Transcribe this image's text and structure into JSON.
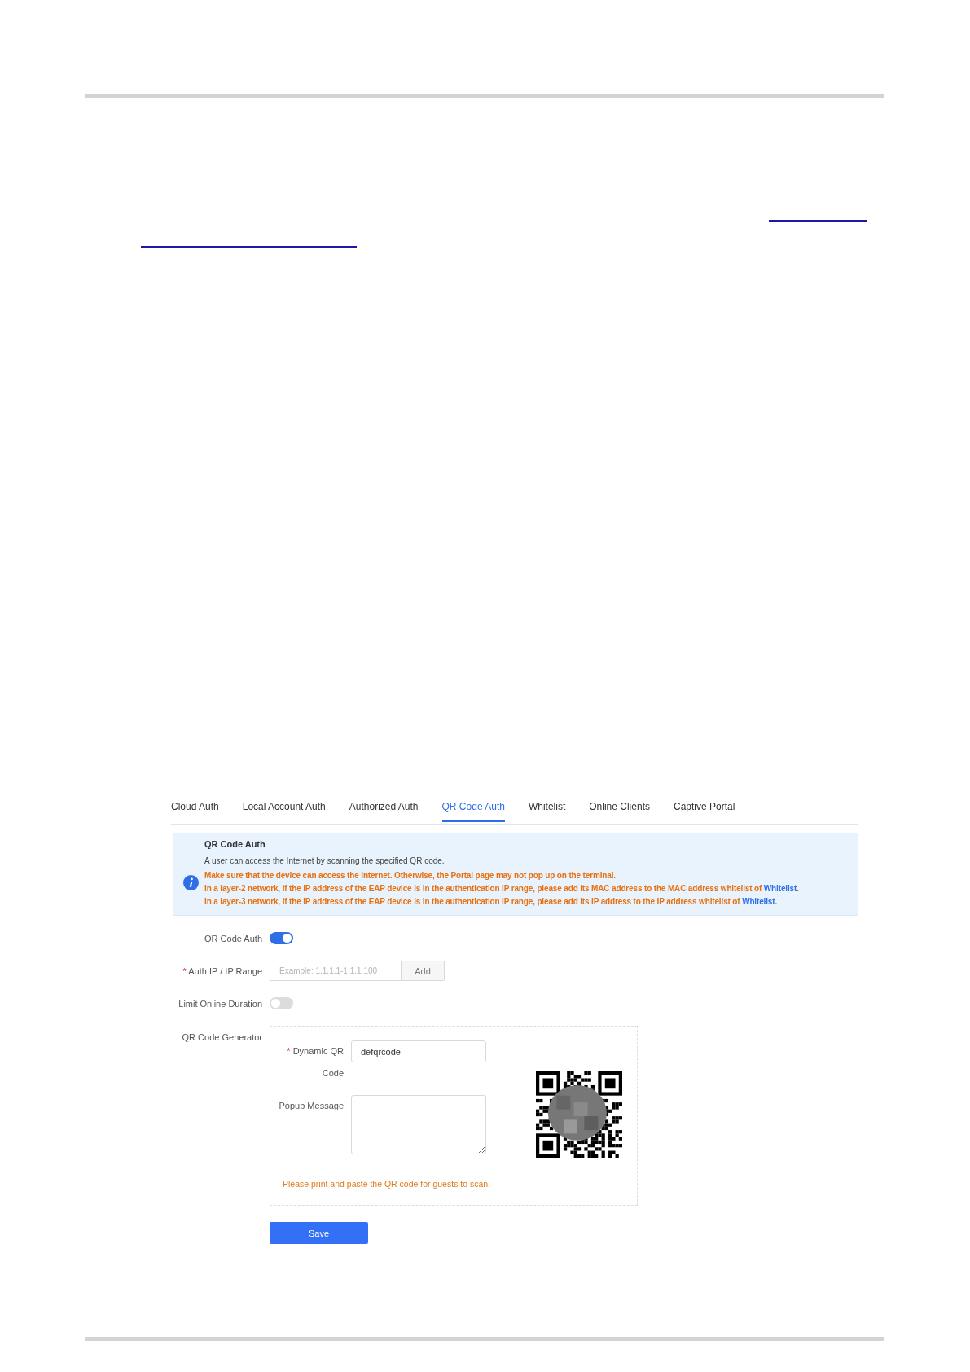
{
  "tabs": [
    {
      "label": "Cloud Auth",
      "selected": false
    },
    {
      "label": "Local Account Auth",
      "selected": false
    },
    {
      "label": "Authorized Auth",
      "selected": false
    },
    {
      "label": "QR Code Auth",
      "selected": true
    },
    {
      "label": "Whitelist",
      "selected": false
    },
    {
      "label": "Online Clients",
      "selected": false
    },
    {
      "label": "Captive Portal",
      "selected": false
    }
  ],
  "notice": {
    "title": "QR Code Auth",
    "description": "A user can access the Internet by scanning the specified QR code.",
    "warnings": [
      {
        "text": "Make sure that the device can access the Internet. Otherwise, the Portal page may not pop up on the terminal."
      },
      {
        "text": "In a layer-2 network, if the IP address of the EAP device is in the authentication IP range, please add its MAC address to the MAC address whitelist of ",
        "link": "Whitelist",
        "end": "."
      },
      {
        "text": "In a layer-3 network, if the IP address of the EAP device is in the authentication IP range, please add its IP address to the IP address whitelist of ",
        "link": "Whitelist",
        "end": "."
      }
    ]
  },
  "qr_code_auth": {
    "label": "QR Code Auth",
    "on": true
  },
  "auth_ip": {
    "required_mark": "*",
    "label": "Auth IP / IP Range",
    "placeholder": "Example: 1.1.1.1-1.1.1.100",
    "button": "Add"
  },
  "limit_online_duration": {
    "label": "Limit Online Duration",
    "on": false
  },
  "generator": {
    "label": "QR Code Generator",
    "dynamic_qr_code": {
      "required_mark": "*",
      "label": "Dynamic QR Code",
      "value": "defqrcode"
    },
    "popup_message": {
      "label": "Popup Message"
    },
    "hint": "Please print and paste the QR code for guests to scan."
  },
  "save_button": "Save"
}
